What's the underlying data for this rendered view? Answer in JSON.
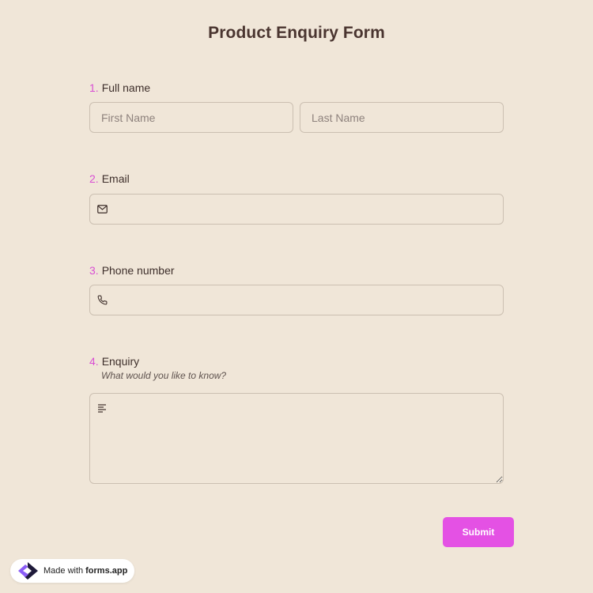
{
  "form": {
    "title": "Product Enquiry Form"
  },
  "questions": [
    {
      "number": "1.",
      "label": "Full name",
      "first_placeholder": "First Name",
      "last_placeholder": "Last Name"
    },
    {
      "number": "2.",
      "label": "Email",
      "icon": "mail-icon"
    },
    {
      "number": "3.",
      "label": "Phone number",
      "icon": "phone-icon"
    },
    {
      "number": "4.",
      "label": "Enquiry",
      "description": "What would you like to know?",
      "icon": "text-lines-icon"
    }
  ],
  "submit": {
    "label": "Submit"
  },
  "badge": {
    "prefix": "Made with",
    "brand": "forms.app"
  },
  "colors": {
    "background": "#f0e6d8",
    "accent": "#e451e4",
    "question_number": "#d94fd3",
    "field_border": "#cbbfb1",
    "title": "#4a3530"
  }
}
